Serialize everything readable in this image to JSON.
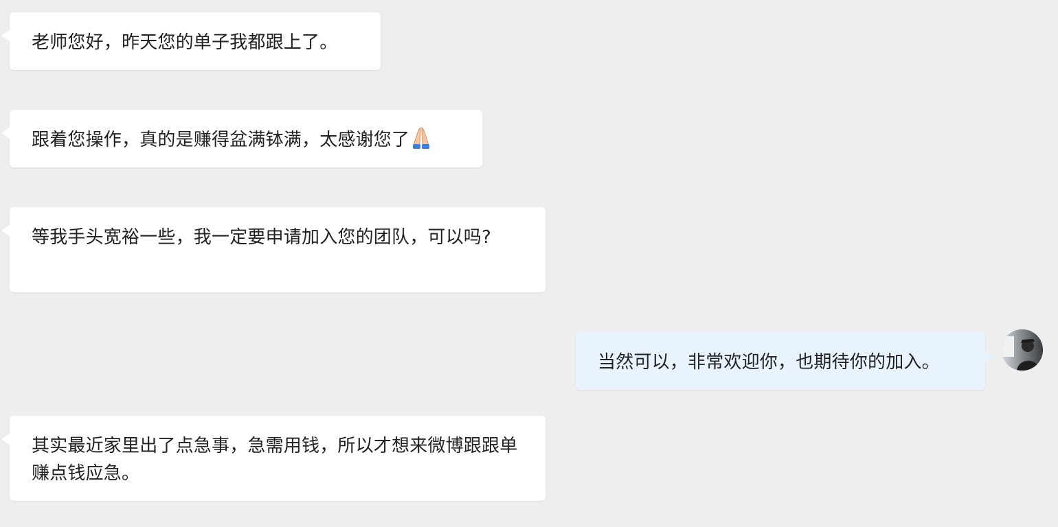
{
  "messages": [
    {
      "side": "incoming",
      "text": "老师您好，昨天您的单子我都跟上了。"
    },
    {
      "side": "incoming",
      "text": "跟着您操作，真的是赚得盆满钵满，太感谢您了",
      "emoji": "folded-hands"
    },
    {
      "side": "incoming",
      "text": "等我手头宽裕一些，我一定要申请加入您的团队，可以吗?"
    },
    {
      "side": "outgoing",
      "text": "当然可以，非常欢迎你，也期待你的加入。"
    },
    {
      "side": "incoming",
      "text": "其实最近家里出了点急事，急需用钱，所以才想来微博跟跟单赚点钱应急。"
    }
  ],
  "colors": {
    "background": "#eeeeee",
    "incoming_bubble": "#ffffff",
    "outgoing_bubble": "#e8f3fd",
    "text": "#222222"
  }
}
